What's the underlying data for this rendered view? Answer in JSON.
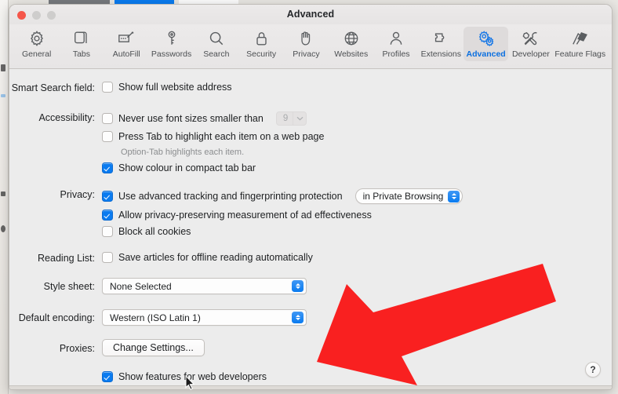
{
  "window": {
    "title": "Advanced",
    "traffic_lights": [
      "close-button",
      "minimize-button",
      "maximize-button"
    ],
    "help_label": "?"
  },
  "toolbar": {
    "items": [
      {
        "label": "General",
        "icon": "gear-icon",
        "selected": false
      },
      {
        "label": "Tabs",
        "icon": "tabs-icon",
        "selected": false
      },
      {
        "label": "AutoFill",
        "icon": "autofill-icon",
        "selected": false
      },
      {
        "label": "Passwords",
        "icon": "key-icon",
        "selected": false
      },
      {
        "label": "Search",
        "icon": "search-icon",
        "selected": false
      },
      {
        "label": "Security",
        "icon": "lock-icon",
        "selected": false
      },
      {
        "label": "Privacy",
        "icon": "hand-icon",
        "selected": false
      },
      {
        "label": "Websites",
        "icon": "globe-icon",
        "selected": false
      },
      {
        "label": "Profiles",
        "icon": "person-icon",
        "selected": false
      },
      {
        "label": "Extensions",
        "icon": "puzzle-icon",
        "selected": false
      },
      {
        "label": "Advanced",
        "icon": "gears-icon",
        "selected": true
      },
      {
        "label": "Developer",
        "icon": "tools-icon",
        "selected": false
      },
      {
        "label": "Feature Flags",
        "icon": "flags-icon",
        "selected": false
      }
    ]
  },
  "settings": {
    "smart_search": {
      "label": "Smart Search field:",
      "show_full_address": {
        "text": "Show full website address",
        "checked": false
      }
    },
    "accessibility": {
      "label": "Accessibility:",
      "min_font": {
        "text": "Never use font sizes smaller than",
        "checked": false,
        "value": "9",
        "disabled": true
      },
      "press_tab": {
        "text": "Press Tab to highlight each item on a web page",
        "checked": false
      },
      "press_tab_hint": "Option-Tab highlights each item.",
      "compact_colour": {
        "text": "Show colour in compact tab bar",
        "checked": true
      }
    },
    "privacy": {
      "label": "Privacy:",
      "advanced_tracking": {
        "text": "Use advanced tracking and fingerprinting protection",
        "checked": true,
        "scope_value": "in Private Browsing"
      },
      "ad_measurement": {
        "text": "Allow privacy-preserving measurement of ad effectiveness",
        "checked": true
      },
      "block_cookies": {
        "text": "Block all cookies",
        "checked": false
      }
    },
    "reading_list": {
      "label": "Reading List:",
      "offline": {
        "text": "Save articles for offline reading automatically",
        "checked": false
      }
    },
    "style_sheet": {
      "label": "Style sheet:",
      "value": "None Selected"
    },
    "default_encoding": {
      "label": "Default encoding:",
      "value": "Western (ISO Latin 1)"
    },
    "proxies": {
      "label": "Proxies:",
      "button_label": "Change Settings..."
    },
    "web_developer": {
      "text": "Show features for web developers",
      "checked": true
    }
  },
  "annotation": {
    "arrow": "red-arrow-pointing-down-left",
    "color": "#f92020",
    "target": "show-features-for-web-developers-checkbox"
  },
  "colors": {
    "accent": "#0a7bf0",
    "window_bg": "#ececec",
    "toolbar_bg": "#eceaea",
    "selected_tool_bg": "#dedbdb",
    "annotation_red": "#f92020"
  }
}
